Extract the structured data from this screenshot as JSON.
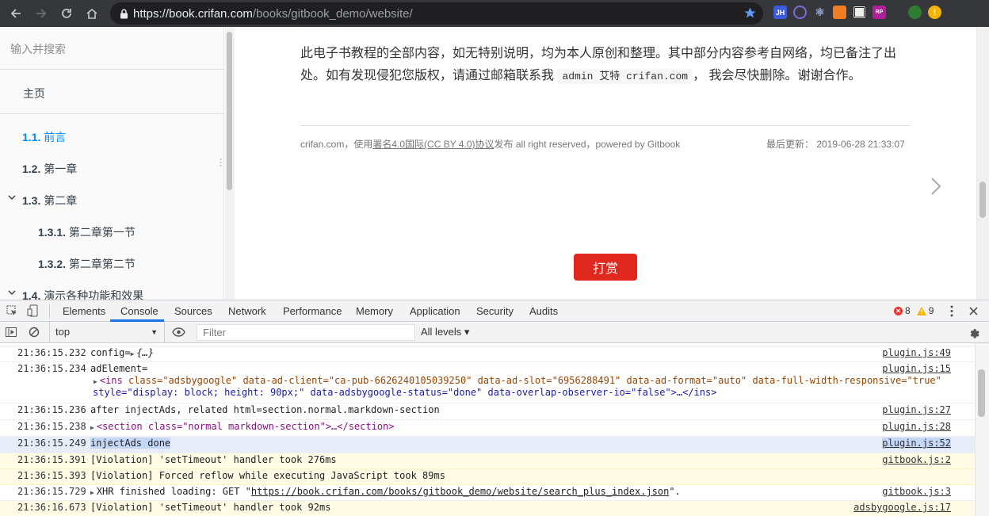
{
  "browser": {
    "url_host": "https://book.crifan.com",
    "url_path": "/books/gitbook_demo/website/"
  },
  "sidebar": {
    "search_placeholder": "输入并搜索",
    "home": "主页",
    "items": [
      {
        "num": "1.1.",
        "label": "前言",
        "active": true
      },
      {
        "num": "1.2.",
        "label": "第一章"
      },
      {
        "num": "1.3.",
        "label": "第二章",
        "expandable": true
      },
      {
        "num": "1.3.1.",
        "label": "第二章第一节"
      },
      {
        "num": "1.3.2.",
        "label": "第二章第二节"
      },
      {
        "num": "1.4.",
        "label": "演示各种功能和效果",
        "expandable": true
      }
    ]
  },
  "content": {
    "intro_line1": "此电子书教程的全部内容，如无特别说明，均为本人原创和整理。其中部分内容参考自网络，均已备注了出",
    "intro_line2a": "处。如有发现侵犯您版权，请通过邮箱联系我 ",
    "intro_code": "admin 艾特 crifan.com",
    "intro_line2b": "， 我会尽快删除。谢谢合作。",
    "footer_prefix": "crifan.com，使用",
    "footer_link": "署名4.0国际(CC BY 4.0)协议",
    "footer_suffix": "发布 all right reserved，powered by Gitbook",
    "last_updated": "最后更新： 2019-06-28 21:33:07",
    "reward_button": "打赏"
  },
  "devtools": {
    "tabs": [
      "Elements",
      "Console",
      "Sources",
      "Network",
      "Performance",
      "Memory",
      "Application",
      "Security",
      "Audits"
    ],
    "active_tab": "Console",
    "error_count": "8",
    "warning_count": "9",
    "context": "top",
    "filter_placeholder": "Filter",
    "levels": "All levels ▾",
    "logs": [
      {
        "ts": "21:36:15.232",
        "msg": "config=",
        "obj": "{…}",
        "src": "plugin.js:49"
      },
      {
        "ts": "21:36:15.234",
        "msg": "adElement=",
        "src": "plugin.js:15",
        "line2": "class=\"adsbygoogle\" data-ad-client=\"ca-pub-6626240105039250\" data-ad-slot=\"6956288491\" data-ad-format=\"auto\" data-full-width-responsive=\"true\"",
        "line3": "style=\"display: block; height: 90px;\" data-adsbygoogle-status=\"done\" data-overlap-observer-io=\"false\">…</ins>"
      },
      {
        "ts": "21:36:15.236",
        "msg": "after injectAds, related html=section.normal.markdown-section",
        "src": "plugin.js:27"
      },
      {
        "ts": "21:36:15.238",
        "msg": "<section class=\"normal markdown-section\">…</section>",
        "src": "plugin.js:28"
      },
      {
        "ts": "21:36:15.249",
        "msg": "injectAds done",
        "src": "plugin.js:52"
      },
      {
        "ts": "21:36:15.391",
        "msg": "[Violation] 'setTimeout' handler took 276ms",
        "src": "gitbook.js:2"
      },
      {
        "ts": "21:36:15.393",
        "msg": "[Violation] Forced reflow while executing JavaScript took 89ms",
        "src": ""
      },
      {
        "ts": "21:36:15.729",
        "msg_prefix": "XHR finished loading: GET \"",
        "msg_link": "https://book.crifan.com/books/gitbook_demo/website/search_plus_index.json",
        "msg_suffix": "\".",
        "src": "gitbook.js:3"
      },
      {
        "ts": "21:36:16.673",
        "msg": "[Violation] 'setTimeout' handler took 92ms",
        "src": "adsbygoogle.js:17"
      }
    ]
  },
  "colors": {
    "accent_link": "#008cff",
    "reward_red": "#e0281e",
    "devtools_tab_underline": "#1a73e8",
    "violation_bg": "#fffbe5"
  }
}
